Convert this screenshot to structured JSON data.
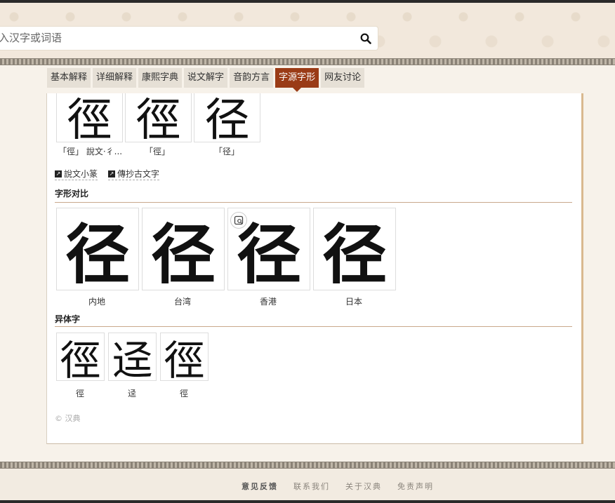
{
  "search": {
    "placeholder": "入汉字或词语"
  },
  "tabs": [
    {
      "label": "基本解释"
    },
    {
      "label": "详细解释"
    },
    {
      "label": "康熙字典"
    },
    {
      "label": "说文解字"
    },
    {
      "label": "音韵方言"
    },
    {
      "label": "字源字形",
      "active": true
    },
    {
      "label": "网友讨论"
    }
  ],
  "seal_row": {
    "tiles": [
      {
        "glyph": "徑",
        "caption": "「徑」 說文·彳..."
      },
      {
        "glyph": "徑",
        "caption": "「徑」"
      },
      {
        "glyph": "径",
        "caption": "「径」"
      }
    ],
    "links": [
      {
        "label": "說文小篆",
        "icon": "external-link-icon"
      },
      {
        "label": "傳抄古文字",
        "icon": "external-link-icon"
      }
    ]
  },
  "compare": {
    "title": "字形对比",
    "items": [
      {
        "glyph": "径",
        "caption": "内地"
      },
      {
        "glyph": "径",
        "caption": "台湾"
      },
      {
        "glyph": "径",
        "caption": "香港"
      },
      {
        "glyph": "径",
        "caption": "日本"
      }
    ]
  },
  "variants": {
    "title": "异体字",
    "items": [
      {
        "glyph": "徑",
        "caption": "徑"
      },
      {
        "glyph": "迳",
        "caption": "迳"
      },
      {
        "glyph": "徑",
        "caption": "徑"
      }
    ]
  },
  "copyright": "© 汉典",
  "footer": {
    "links": [
      "意见反馈",
      "联系我们",
      "关于汉典",
      "免责声明"
    ]
  },
  "colors": {
    "active_tab": "#9a3b16",
    "header_bg": "#f2e8dc",
    "accent_border": "#d9b98f"
  }
}
